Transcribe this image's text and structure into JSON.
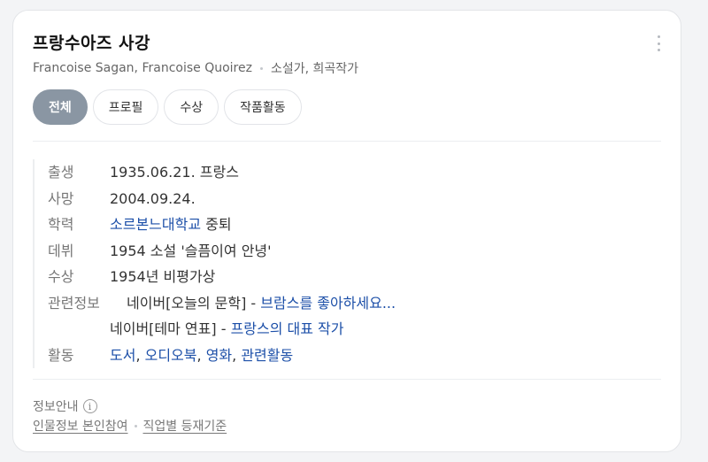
{
  "profile": {
    "name": "프랑수아즈 사강",
    "aliases": "Francoise Sagan, Francoise Quoirez",
    "occupation": "소설가, 희곡작가"
  },
  "tabs": [
    {
      "label": "전체",
      "active": true
    },
    {
      "label": "프로필",
      "active": false
    },
    {
      "label": "수상",
      "active": false
    },
    {
      "label": "작품활동",
      "active": false
    }
  ],
  "info": {
    "birth": {
      "label": "출생",
      "value": "1935.06.21. 프랑스"
    },
    "death": {
      "label": "사망",
      "value": "2004.09.24."
    },
    "education": {
      "label": "학력",
      "link": "소르본느대학교",
      "suffix": " 중퇴"
    },
    "debut": {
      "label": "데뷔",
      "value": "1954 소설 '슬픔이여 안녕'"
    },
    "award": {
      "label": "수상",
      "value": "1954년 비평가상"
    },
    "related": {
      "label": "관련정보",
      "items": [
        {
          "prefix": "네이버[오늘의 문학] - ",
          "link": "브람스를 좋아하세요..."
        },
        {
          "prefix": "네이버[테마 연표] - ",
          "link": "프랑스의 대표 작가"
        }
      ]
    },
    "activity": {
      "label": "활동",
      "links": [
        "도서",
        "오디오북",
        "영화",
        "관련활동"
      ],
      "separator": ", "
    }
  },
  "footer": {
    "title": "정보안내",
    "info_icon_glyph": "i",
    "links": [
      "인물정보 본인참여",
      "직업별 등재기준"
    ]
  },
  "colors": {
    "link": "#1c4fa8",
    "active_tab": "#8a96a3"
  }
}
